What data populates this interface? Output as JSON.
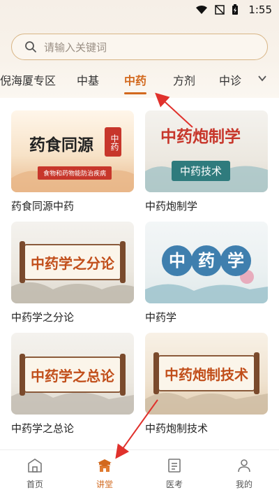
{
  "status_bar": {
    "time": "1:55"
  },
  "search": {
    "placeholder": "请输入关键词"
  },
  "tabs": [
    {
      "label": "倪海厦专区"
    },
    {
      "label": "中基"
    },
    {
      "label": "中药"
    },
    {
      "label": "方剂"
    },
    {
      "label": "中诊"
    }
  ],
  "cards": [
    {
      "title": "药食同源中药",
      "thumb_title": "药食同源",
      "thumb_seal": "中药",
      "thumb_sub": "食物和药物能防治疾病"
    },
    {
      "title": "中药炮制学",
      "thumb_title": "中药炮制学",
      "thumb_sub": "中药技术"
    },
    {
      "title": "中药学之分论",
      "thumb_title": "中药学之分论"
    },
    {
      "title": "中药学",
      "thumb_title_1": "中",
      "thumb_title_2": "药",
      "thumb_title_3": "学"
    },
    {
      "title": "中药学之总论",
      "thumb_title": "中药学之总论"
    },
    {
      "title": "中药炮制技术",
      "thumb_title": "中药炮制技术"
    }
  ],
  "bottom_nav": [
    {
      "label": "首页"
    },
    {
      "label": "讲堂"
    },
    {
      "label": "医考"
    },
    {
      "label": "我的"
    }
  ],
  "colors": {
    "accent": "#d2691e",
    "annotation_arrow": "#e0312c"
  }
}
